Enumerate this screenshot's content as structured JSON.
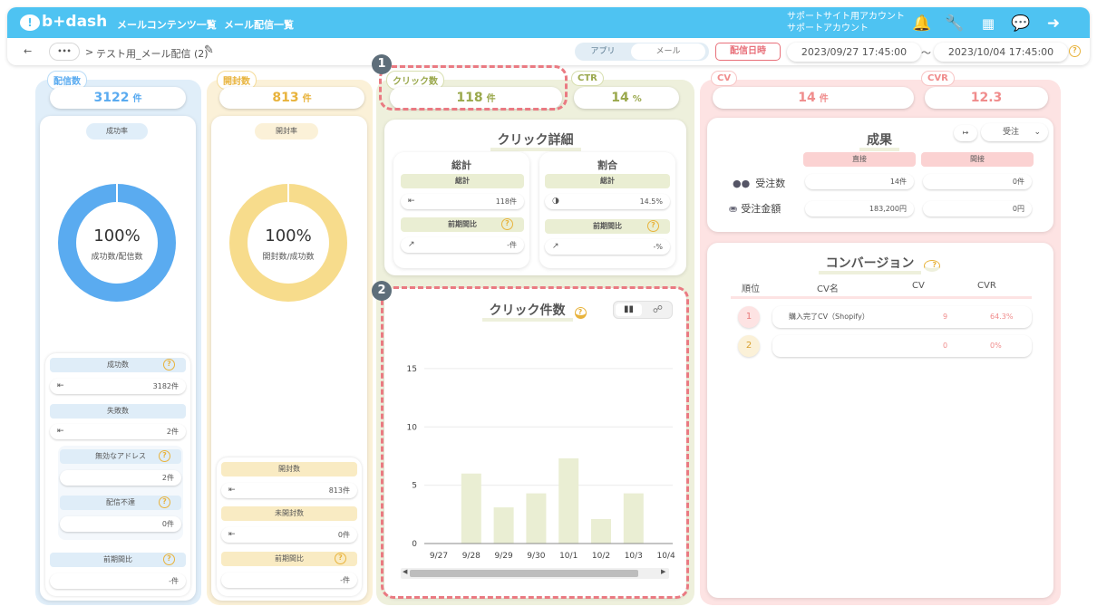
{
  "header": {
    "logo": "b+dash",
    "nav": [
      "メールコンテンツ一覧",
      "メール配信一覧"
    ],
    "account_line1": "サポートサイト用アカウント",
    "account_line2": "サポートアカウント",
    "breadcrumb": "テスト用_メール配信 (2)",
    "toggle_app": "アプリ",
    "toggle_mail": "メール",
    "date_label": "配信日時",
    "date_from": "2023/09/27 17:45:00",
    "tilde": "〜",
    "date_to": "2023/10/04 17:45:00",
    "back": "←",
    "more": "•••",
    "chevron": ">"
  },
  "delivery": {
    "tag": "配信数",
    "value": "3122",
    "unit": "件",
    "rate_label": "成功率",
    "donut_value": "100%",
    "donut_caption": "成功数/配信数",
    "success_label": "成功数",
    "success_value": "3182件",
    "fail_label": "失敗数",
    "fail_value": "2件",
    "invalid_label": "無効なアドレス",
    "invalid_value": "2件",
    "undeliverable_label": "配信不達",
    "undeliverable_value": "0件",
    "prev_label": "前期間比",
    "prev_value": "-件",
    "donut_fill": 1.0,
    "color": "#5aabf0"
  },
  "opens": {
    "tag": "開封数",
    "value": "813",
    "unit": "件",
    "rate_label": "開封率",
    "donut_value": "100%",
    "donut_caption": "開封数/成功数",
    "open_label": "開封数",
    "open_value": "813件",
    "unopen_label": "未開封数",
    "unopen_value": "0件",
    "prev_label": "前期間比",
    "prev_value": "-件",
    "donut_fill": 1.0,
    "color": "#f7dc8c"
  },
  "clicks": {
    "tag": "クリック数",
    "value": "118",
    "unit": "件",
    "ctr_tag": "CTR",
    "ctr_value": "14",
    "ctr_unit": "%",
    "detail_title": "クリック詳細",
    "total_title": "総計",
    "total_label": "総計",
    "total_value": "118件",
    "total_prev_label": "前期間比",
    "total_prev_value": "-件",
    "ratio_title": "割合",
    "ratio_label": "総計",
    "ratio_value": "14.5%",
    "ratio_prev_label": "前期間比",
    "ratio_prev_value": "-%",
    "chart_title": "クリック件数"
  },
  "badges": {
    "one": "1",
    "two": "2"
  },
  "results": {
    "cv_tag": "CV",
    "cv_value": "14",
    "cv_unit": "件",
    "cvr_tag": "CVR",
    "cvr_value": "12.3",
    "title": "成果",
    "select_value": "受注",
    "col_direct": "直接",
    "col_indirect": "間接",
    "orders_label": "受注数",
    "orders_direct": "14件",
    "orders_indirect": "0件",
    "amount_label": "受注金額",
    "amount_direct": "183,200円",
    "amount_indirect": "0円"
  },
  "conversion": {
    "title": "コンバージョン",
    "headers": [
      "順位",
      "CV名",
      "CV",
      "CVR"
    ],
    "rows": [
      {
        "rank": "1",
        "name": "購入完了CV（Shopify）",
        "cv": "9",
        "cvr": "64.3%"
      },
      {
        "rank": "2",
        "name": "",
        "cv": "0",
        "cvr": "0%"
      }
    ]
  },
  "chart_data": {
    "type": "bar",
    "title": "クリック件数",
    "categories": [
      "9/27",
      "9/28",
      "9/29",
      "9/30",
      "10/1",
      "10/2",
      "10/3",
      "10/4"
    ],
    "values": [
      0,
      6,
      3.1,
      4.3,
      7.3,
      2.1,
      4.3,
      0
    ],
    "yticks": [
      0,
      5,
      10,
      15
    ],
    "ylim": [
      0,
      16
    ],
    "color": "#eaeed3",
    "grid": true
  }
}
